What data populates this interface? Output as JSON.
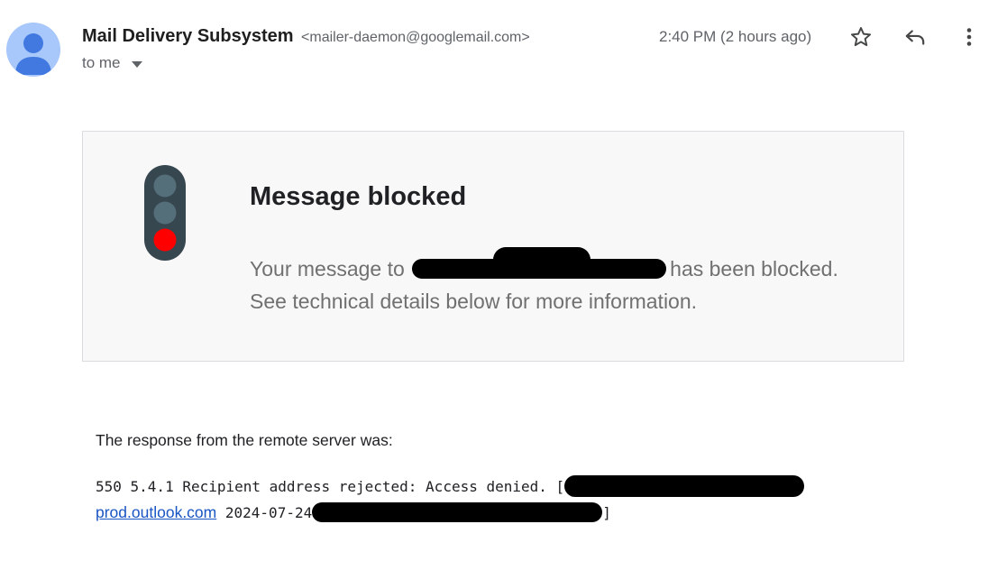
{
  "header": {
    "sender_name": "Mail Delivery Subsystem",
    "sender_email": "<mailer-daemon@googlemail.com>",
    "to_label": "to me",
    "timestamp": "2:40 PM (2 hours ago)",
    "avatar_color": "#a8c7fa",
    "avatar_figure_color": "#4179e0",
    "icons": [
      "star-icon",
      "reply-icon",
      "more-vert-icon"
    ]
  },
  "card": {
    "title": "Message blocked",
    "body_prefix": "Your message to",
    "body_suffix": "has been blocked.",
    "body_line2": "See technical details below for more information.",
    "icon": "traffic-light-icon",
    "light_active_color": "#ff0000"
  },
  "response": {
    "heading": "The response from the remote server was:",
    "code_line1": "550 5.4.1 Recipient address rejected: Access denied. [",
    "link_text": "prod.outlook.com",
    "code_line2_date": "2024-07-24",
    "code_line2_end": "]",
    "link_color": "#1a55c4"
  }
}
